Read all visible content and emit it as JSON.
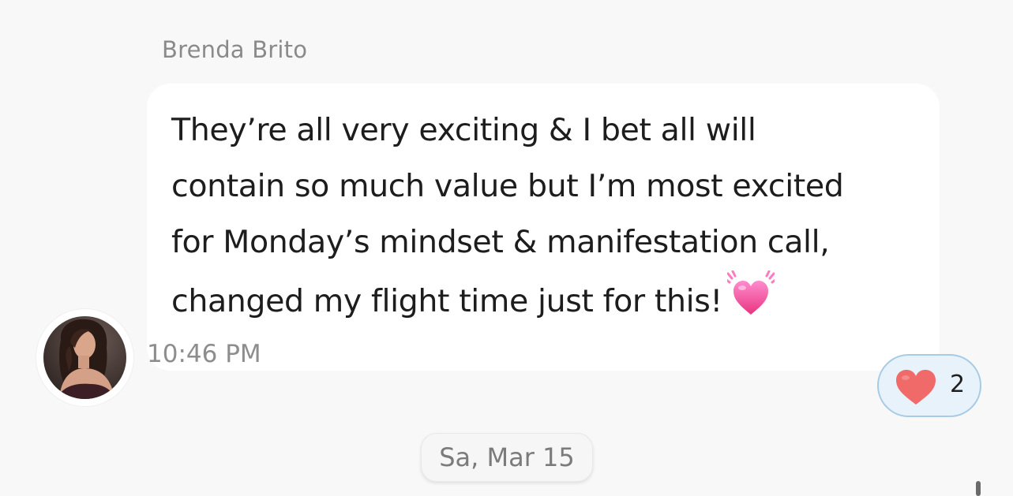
{
  "message": {
    "sender_name": "Brenda Brito",
    "text_lines": [
      "They’re all very exciting & I bet all will",
      "contain so much value but I’m most excited",
      "for Monday’s mindset & manifestation call,",
      "changed my flight time just for this!"
    ],
    "emoji": "growing-heart-emoji",
    "timestamp": "10:46 PM"
  },
  "reaction": {
    "icon": "red-heart-icon",
    "count": "2"
  },
  "date_separator": {
    "label": "Sa, Mar 15"
  },
  "colors": {
    "background": "#f8f8f8",
    "bubble": "#ffffff",
    "reaction_border": "#a6cbe4",
    "reaction_fill": "#e7f2fa",
    "heart": "#f06a6a"
  }
}
